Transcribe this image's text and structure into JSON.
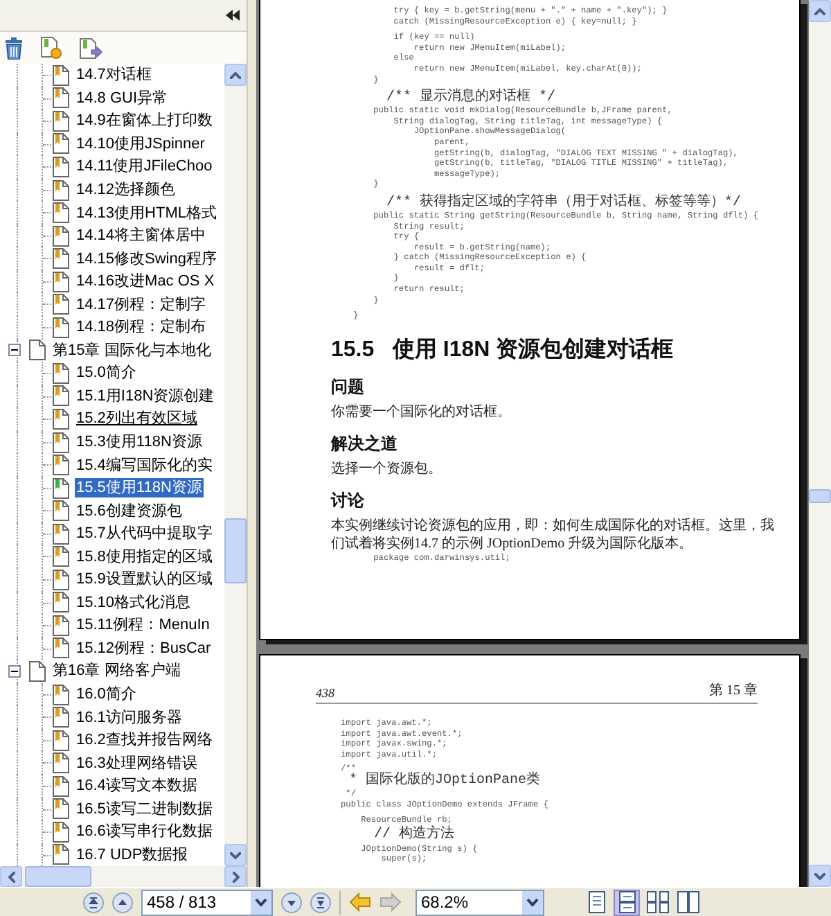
{
  "tree": [
    {
      "kind": "section",
      "label": "14.7对话框",
      "selected": false,
      "hovered": false
    },
    {
      "kind": "section",
      "label": "14.8  GUI异常",
      "selected": false,
      "hovered": false
    },
    {
      "kind": "section",
      "label": "14.9在窗体上打印数",
      "selected": false,
      "hovered": false
    },
    {
      "kind": "section",
      "label": "14.10使用JSpinner",
      "selected": false,
      "hovered": false
    },
    {
      "kind": "section",
      "label": "14.11使用JFileChoo",
      "selected": false,
      "hovered": false
    },
    {
      "kind": "section",
      "label": "14.12选择颜色",
      "selected": false,
      "hovered": false
    },
    {
      "kind": "section",
      "label": "14.13使用HTML格式",
      "selected": false,
      "hovered": false
    },
    {
      "kind": "section",
      "label": "14.14将主窗体居中",
      "selected": false,
      "hovered": false
    },
    {
      "kind": "section",
      "label": "14.15修改Swing程序",
      "selected": false,
      "hovered": false
    },
    {
      "kind": "section",
      "label": "14.16改进Mac OS X",
      "selected": false,
      "hovered": false
    },
    {
      "kind": "section",
      "label": "14.17例程：定制字",
      "selected": false,
      "hovered": false
    },
    {
      "kind": "section",
      "label": "14.18例程：定制布",
      "selected": false,
      "hovered": false
    },
    {
      "kind": "chapter",
      "label": "第15章  国际化与本地化",
      "selected": false,
      "hovered": false,
      "expanded": true,
      "children": [
        {
          "kind": "section",
          "label": "15.0简介",
          "selected": false,
          "hovered": false
        },
        {
          "kind": "section",
          "label": "15.1用I18N资源创建",
          "selected": false,
          "hovered": false
        },
        {
          "kind": "section",
          "label": "15.2列出有效区域",
          "selected": false,
          "hovered": true
        },
        {
          "kind": "section",
          "label": "15.3使用118N资源",
          "selected": false,
          "hovered": false
        },
        {
          "kind": "section",
          "label": "15.4编写国际化的实",
          "selected": false,
          "hovered": false
        },
        {
          "kind": "section",
          "label": "15.5使用118N资源",
          "selected": true,
          "hovered": false
        },
        {
          "kind": "section",
          "label": "15.6创建资源包",
          "selected": false,
          "hovered": false
        },
        {
          "kind": "section",
          "label": "15.7从代码中提取字",
          "selected": false,
          "hovered": false
        },
        {
          "kind": "section",
          "label": "15.8使用指定的区域",
          "selected": false,
          "hovered": false
        },
        {
          "kind": "section",
          "label": "15.9设置默认的区域",
          "selected": false,
          "hovered": false
        },
        {
          "kind": "section",
          "label": "15.10格式化消息",
          "selected": false,
          "hovered": false
        },
        {
          "kind": "section",
          "label": "15.11例程：MenuIn",
          "selected": false,
          "hovered": false
        },
        {
          "kind": "section",
          "label": "15.12例程：BusCar",
          "selected": false,
          "hovered": false
        }
      ]
    },
    {
      "kind": "chapter",
      "label": "第16章  网络客户端",
      "selected": false,
      "hovered": false,
      "expanded": true,
      "children": [
        {
          "kind": "section",
          "label": "16.0简介",
          "selected": false,
          "hovered": false
        },
        {
          "kind": "section",
          "label": "16.1访问服务器",
          "selected": false,
          "hovered": false
        },
        {
          "kind": "section",
          "label": "16.2查找并报告网络",
          "selected": false,
          "hovered": false
        },
        {
          "kind": "section",
          "label": "16.3处理网络错误",
          "selected": false,
          "hovered": false
        },
        {
          "kind": "section",
          "label": "16.4读写文本数据",
          "selected": false,
          "hovered": false
        },
        {
          "kind": "section",
          "label": "16.5读写二进制数据",
          "selected": false,
          "hovered": false
        },
        {
          "kind": "section",
          "label": "16.6读写串行化数据",
          "selected": false,
          "hovered": false
        },
        {
          "kind": "section",
          "label": "16.7  UDP数据报",
          "selected": false,
          "hovered": false
        }
      ]
    }
  ],
  "pages": [
    {
      "blocks": [
        {
          "kind": "code",
          "groups": [
            [
              "        try { key = b.getString(menu + \".\" + name + \".key\"); }",
              "        catch (MissingResourceException e) { key=null; }"
            ],
            [
              "        if (key == null)",
              "            return new JMenuItem(miLabel);",
              "        else",
              "            return new JMenuItem(miLabel, key.charAt(0));",
              "    }"
            ],
            [
              "    /** 显示消息的对话框 */",
              "    public static void mkDialog(ResourceBundle b,JFrame parent,",
              "        String dialogTag, String titleTag, int messageType) {",
              "            JOptionPane.showMessageDialog(",
              "                parent,",
              "                getString(b, dialogTag, \"DIALOG TEXT MISSING \" + dialogTag),",
              "                getString(b, titleTag, \"DIALOG TITLE MISSING\" + titleTag),",
              "                messageType);",
              "    }"
            ],
            [
              "    /** 获得指定区域的字符串（用于对话框、标签等等）*/",
              "    public static String getString(ResourceBundle b, String name, String dflt) {",
              "        String result;",
              "        try {",
              "            result = b.getString(name);",
              "        } catch (MissingResourceException e) {",
              "            result = dflt;",
              "        }",
              "        return result;",
              "    }"
            ],
            [
              "}"
            ]
          ]
        },
        {
          "kind": "title",
          "text": "15.5   使用 I18N 资源包创建对话框"
        },
        {
          "kind": "heading",
          "text": "问题"
        },
        {
          "kind": "body",
          "text": "你需要一个国际化的对话框。"
        },
        {
          "kind": "heading",
          "text": "解决之道"
        },
        {
          "kind": "body",
          "text": "选择一个资源包。"
        },
        {
          "kind": "heading",
          "text": "讨论"
        },
        {
          "kind": "body",
          "text": "本实例继续讨论资源包的应用，即：如何生成国际化的对话框。这里，我们试着将实例14.7 的示例 JOptionDemo 升级为国际化版本。"
        },
        {
          "kind": "code",
          "groups": [
            [
              "    package com.darwinsys.util;"
            ]
          ]
        }
      ]
    },
    {
      "header": {
        "number": "438",
        "chapter": "第 15 章"
      },
      "blocks": [
        {
          "kind": "code",
          "groups": [
            [
              "import java.awt.*;",
              "import java.awt.event.*;",
              "import javax.swing.*;",
              "import java.util.*;"
            ],
            [
              "/**",
              " * 国际化版的JOptionPane类",
              " */",
              "public class JOptionDemo extends JFrame {"
            ],
            [
              "    ResourceBundle rb;"
            ],
            [
              "    // 构造方法",
              "    JOptionDemo(String s) {",
              "        super(s);"
            ]
          ]
        }
      ]
    }
  ],
  "toolbar": {
    "page_field": "458 / 813",
    "zoom_field": "68.2%",
    "back": {
      "disabled": false
    },
    "forward": {
      "disabled": true
    },
    "views": [
      {
        "kind": "single",
        "selected": false
      },
      {
        "kind": "continuous",
        "selected": true
      },
      {
        "kind": "grid",
        "selected": false
      },
      {
        "kind": "columns",
        "selected": false
      }
    ]
  }
}
